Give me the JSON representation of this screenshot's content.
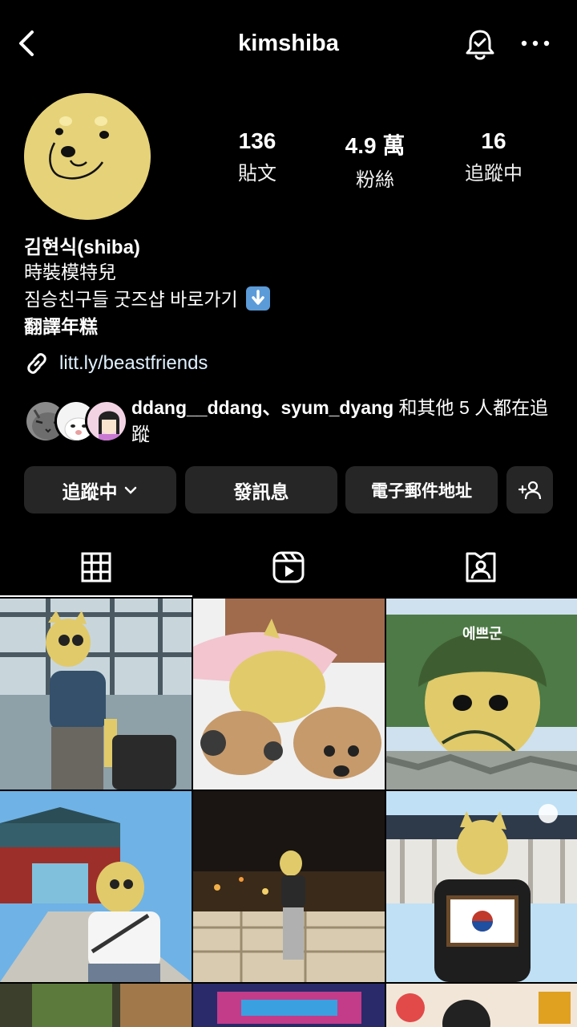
{
  "header": {
    "username": "kimshiba",
    "back_icon": "chevron-left-icon",
    "bell_icon": "bell-check-icon",
    "more_icon": "more-dots-icon"
  },
  "profile": {
    "avatar_icon": "avatar",
    "stats": [
      {
        "value": "136",
        "label": "貼文"
      },
      {
        "value": "4.9 萬",
        "label": "粉絲"
      },
      {
        "value": "16",
        "label": "追蹤中"
      }
    ],
    "name": "김현식(shiba)",
    "bio_lines": [
      "時裝模特兒",
      "짐승친구들 굿즈샵 바로가기",
      "翻譯年糕"
    ],
    "link": "litt.ly/beastfriends"
  },
  "followed_by": {
    "names": "ddang__ddang、syum_dyang",
    "suffix": " 和其他 5 人都在追蹤"
  },
  "actions": {
    "following": "追蹤中",
    "message": "發訊息",
    "email": "電子郵件地址"
  },
  "tabs": [
    "grid-icon",
    "reels-icon",
    "tagged-icon"
  ],
  "colors": {
    "background": "#000000",
    "button": "#262626",
    "avatar": "#e6d278",
    "link": "#e0f1ff"
  }
}
